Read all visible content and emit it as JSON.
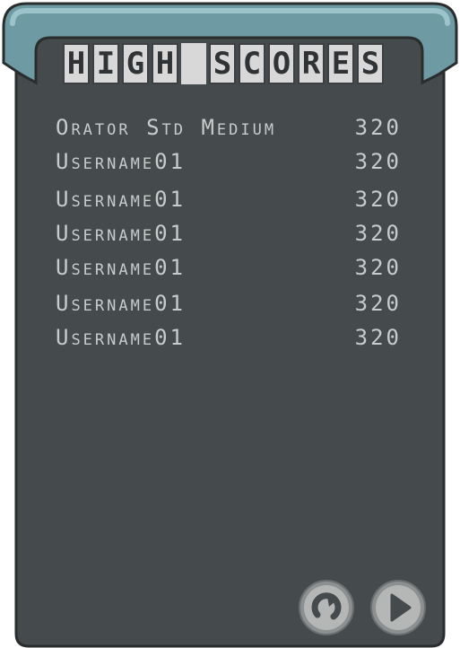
{
  "title": {
    "text": "HIGH SCORES"
  },
  "scores": [
    {
      "name": "Orator Std Medium",
      "score": "320"
    },
    {
      "name": "Username01",
      "score": "320"
    },
    {
      "name": "Username01",
      "score": "320"
    },
    {
      "name": "Username01",
      "score": "320"
    },
    {
      "name": "Username01",
      "score": "320"
    },
    {
      "name": "Username01",
      "score": "320"
    },
    {
      "name": "Username01",
      "score": "320"
    }
  ],
  "colors": {
    "panel": "#454a4c",
    "panel_border": "#2a2d2e",
    "tab_teal": "#6d9aa3",
    "tab_teal_light": "#9cc3ca",
    "text": "#c9cbcb",
    "button_fill": "#b5b7b7",
    "button_ring": "#6a6e70"
  },
  "buttons": {
    "replay_icon": "replay-icon",
    "play_icon": "play-icon"
  }
}
